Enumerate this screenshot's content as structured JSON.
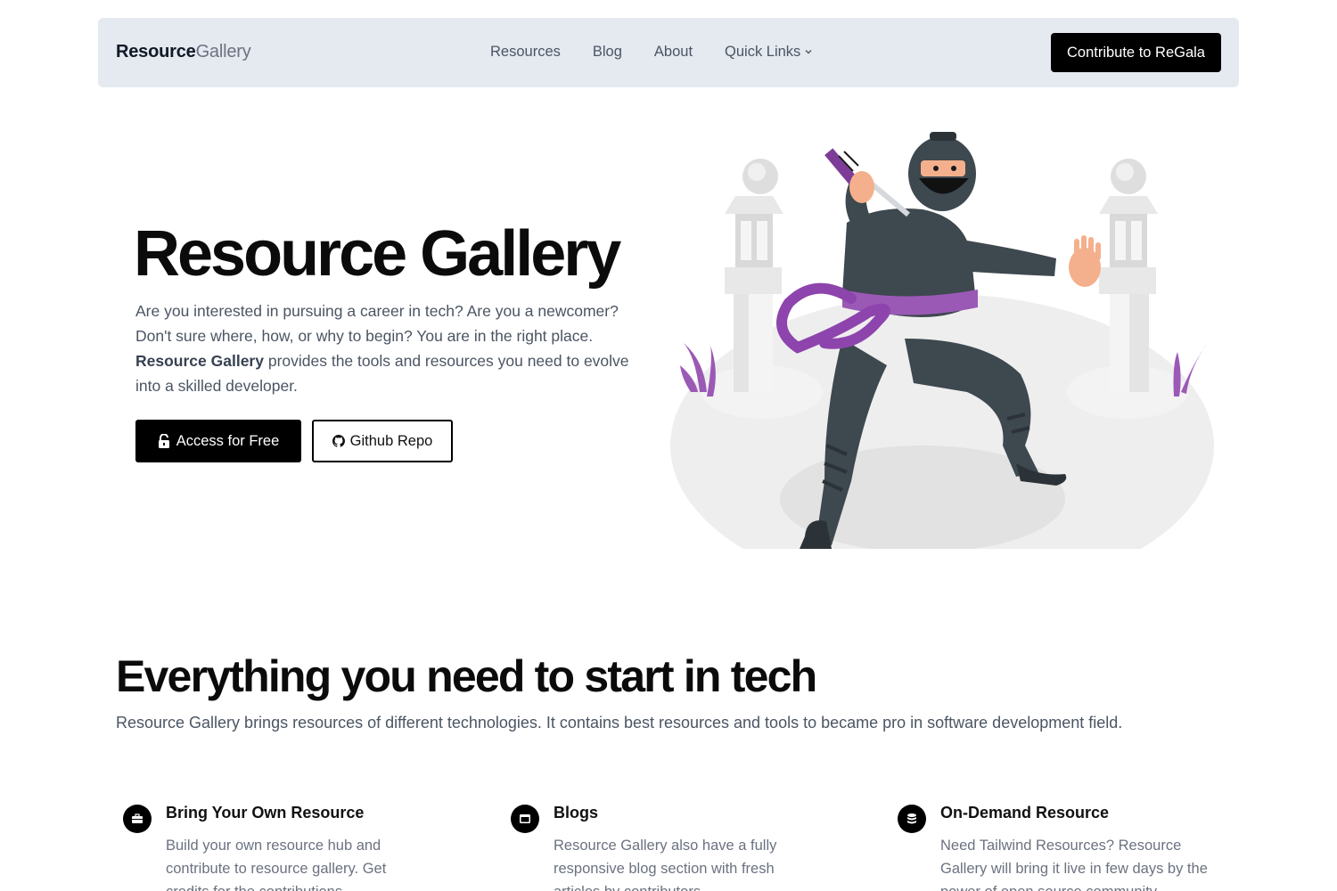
{
  "navbar": {
    "brand_bold": "Resource",
    "brand_light": "Gallery",
    "links": [
      "Resources",
      "Blog",
      "About",
      "Quick Links"
    ],
    "cta": "Contribute to ReGala"
  },
  "hero": {
    "title": "Resource Gallery",
    "desc_before": "Are you interested in pursuing a career in tech? Are you a newcomer? Don't sure where, how, or why to begin? You are in the right place. ",
    "desc_bold": "Resource Gallery",
    "desc_after": " provides the tools and resources you need to evolve into a skilled developer.",
    "primary_button": "Access for Free",
    "secondary_button": "Github Repo"
  },
  "section": {
    "title": "Everything you need to start in tech",
    "subtitle": "Resource Gallery brings resources of different technologies. It contains best resources and tools to became pro in software development field."
  },
  "features": [
    {
      "title": "Bring Your Own Resource",
      "desc": "Build your own resource hub and contribute to resource gallery. Get credits for the contributions.",
      "icon": "briefcase-icon"
    },
    {
      "title": "Blogs",
      "desc": "Resource Gallery also have a fully responsive blog section with fresh articles by contributors.",
      "icon": "browser-window-icon"
    },
    {
      "title": "On-Demand Resource",
      "desc": "Need Tailwind Resources? Resource Gallery will bring it live in few days by the power of open source community.",
      "icon": "database-icon"
    }
  ],
  "colors": {
    "navbar_bg": "#e5e9f0",
    "accent": "#000000",
    "ninja_purple": "#9b59b6",
    "ninja_suit": "#3e484f"
  }
}
